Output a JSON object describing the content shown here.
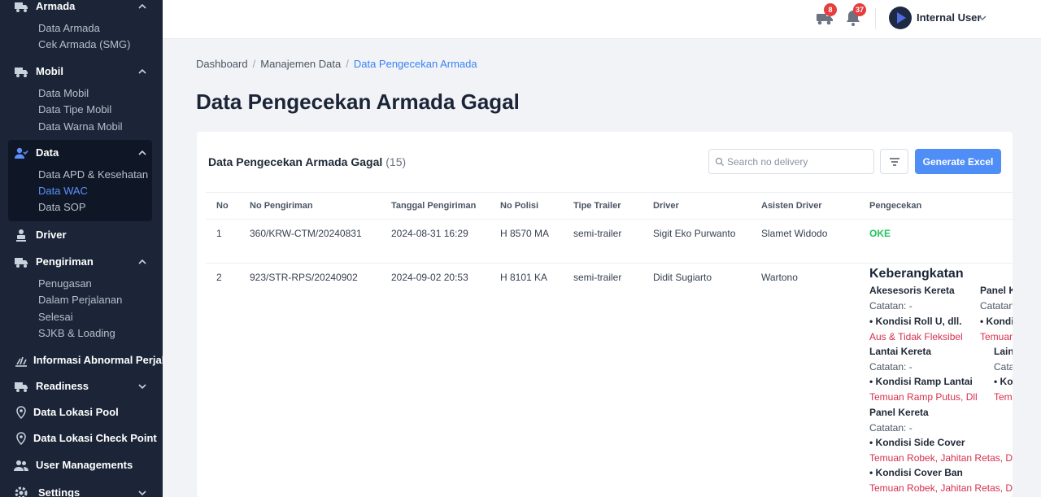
{
  "sidebar": {
    "groups": [
      {
        "label": "Armada",
        "icon": "truck-icon",
        "items": [
          "Data Armada",
          "Cek Armada (SMG)"
        ]
      },
      {
        "label": "Mobil",
        "icon": "truck-icon",
        "items": [
          "Data Mobil",
          "Data Tipe Mobil",
          "Data Warna Mobil"
        ]
      },
      {
        "label": "Data",
        "icon": "user-check-icon",
        "items": [
          "Data APD & Kesehatan",
          "Data WAC",
          "Data SOP"
        ],
        "active_item": "Data WAC"
      },
      {
        "label": "Driver",
        "icon": "driver-icon",
        "items": []
      },
      {
        "label": "Pengiriman",
        "icon": "truck-icon",
        "items": [
          "Penugasan",
          "Dalam Perjalanan",
          "Selesai",
          "SJKB & Loading"
        ]
      },
      {
        "label": "Informasi Abnormal Perjal",
        "icon": "alert-burst-icon",
        "items": []
      },
      {
        "label": "Readiness",
        "icon": "truck-icon",
        "items": []
      },
      {
        "label": "Data Lokasi Pool",
        "icon": "map-pin-icon",
        "items": []
      },
      {
        "label": "Data Lokasi Check Point",
        "icon": "map-pin-icon",
        "items": []
      },
      {
        "label": "User Managements",
        "icon": "users-icon",
        "items": []
      },
      {
        "label": "Settings",
        "icon": "gear-icon",
        "items": []
      }
    ]
  },
  "topbar": {
    "truck_badge": "8",
    "bell_badge": "37",
    "user_name": "Internal User"
  },
  "breadcrumb": [
    "Dashboard",
    "Manajemen Data",
    "Data Pengecekan Armada"
  ],
  "page_title": "Data Pengecekan Armada Gagal",
  "card": {
    "title": "Data Pengecekan Armada Gagal",
    "count": "(15)",
    "search_placeholder": "Search no delivery",
    "generate_label": "Generate Excel"
  },
  "table": {
    "headers": [
      "No",
      "No Pengiriman",
      "Tanggal Pengiriman",
      "No Polisi",
      "Tipe Trailer",
      "Driver",
      "Asisten Driver",
      "Pengecekan"
    ],
    "rows": [
      {
        "no": "1",
        "no_pengiriman": "360/KRW-CTM/20240831",
        "tanggal": "2024-08-31 16:29",
        "no_polisi": "H 8570 MA",
        "tipe_trailer": "semi-trailer",
        "driver": "Sigit Eko Purwanto",
        "asisten": "Slamet Widodo",
        "pengecekan": "OKE"
      },
      {
        "no": "2",
        "no_pengiriman": "923/STR-RPS/20240902",
        "tanggal": "2024-09-02 20:53",
        "no_polisi": "H 8101 KA",
        "tipe_trailer": "semi-trailer",
        "driver": "Didit Sugiarto",
        "asisten": "Wartono",
        "pengecekan": ""
      }
    ]
  },
  "pengecekan_detail": {
    "title": "Keberangkatan",
    "col1": [
      {
        "heading": "Akesesoris Kereta",
        "note": "Catatan: -",
        "item": "• Kondisi Roll U, dll.",
        "finding": "Aus & Tidak Fleksibel"
      },
      {
        "heading": "Lantai Kereta",
        "note": "Catatan: -",
        "item": "• Kondisi Ramp Lantai",
        "finding": "Temuan Ramp Putus, Dll"
      },
      {
        "heading": "Panel Kereta",
        "note": "Catatan: -",
        "item": "• Kondisi Side Cover",
        "finding": "Temuan Robek, Jahitan Retas, D"
      },
      {
        "item": "• Kondisi Cover Ban",
        "finding": "Temuan Robek, Jahitan Retas, D"
      }
    ],
    "col2": [
      {
        "heading": "Panel K",
        "note": "Catatan",
        "item": "• Kondi",
        "finding": "Temuan"
      },
      {
        "heading": "Lain",
        "note": "Cata",
        "item": "• Ko",
        "finding": "Tem"
      }
    ]
  }
}
